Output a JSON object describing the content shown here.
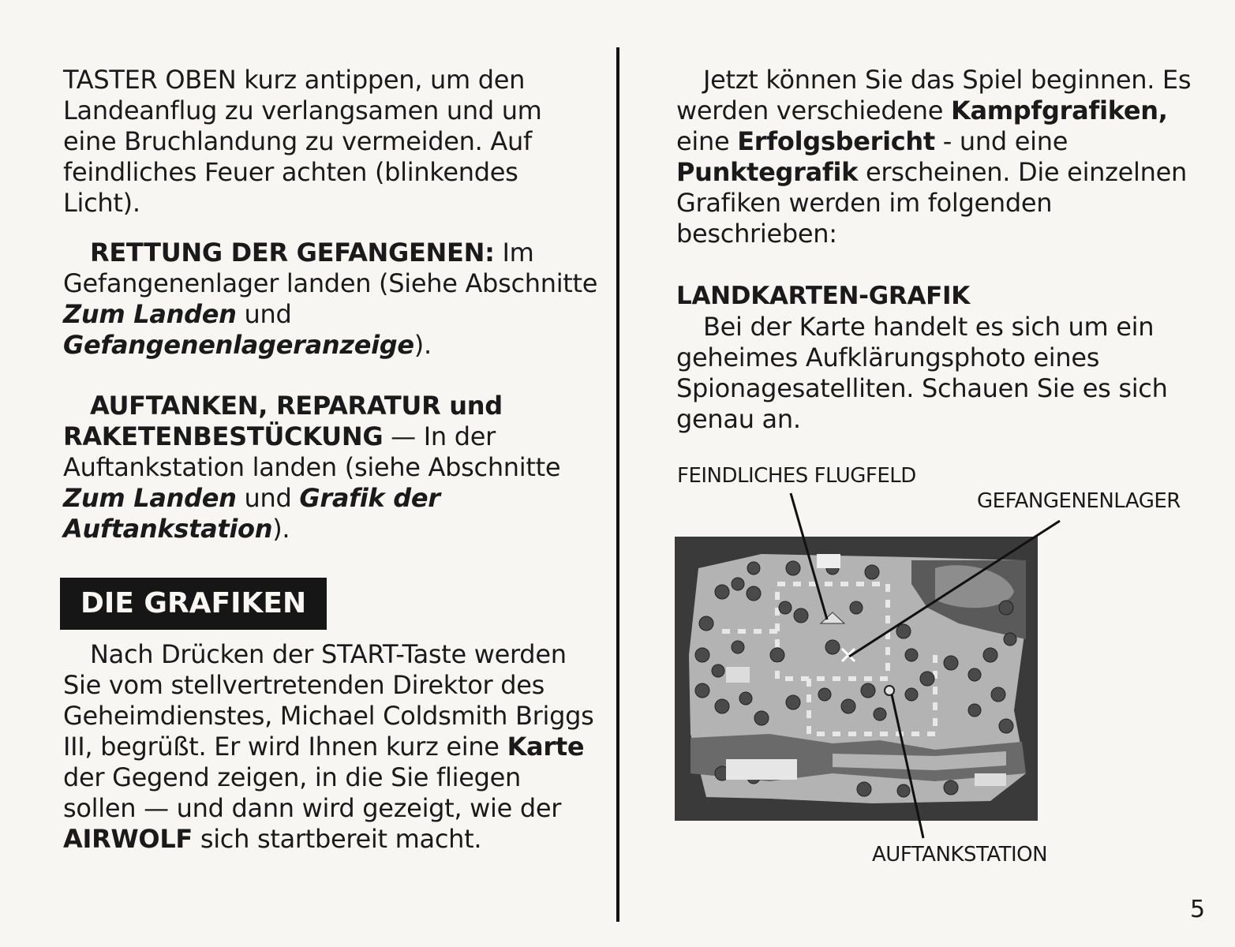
{
  "left": {
    "p1": "TASTER OBEN kurz antippen, um den Landeanflug zu verlangsamen und um eine Bruchlandung zu vermeiden. Auf feindliches Feuer achten (blinkendes Licht).",
    "p2_head": "RETTUNG DER GEFANGENEN:",
    "p2_a": " Im Gefangenenlager landen (Siehe Abschnitte ",
    "p2_b": "Zum Landen",
    "p2_c": " und ",
    "p2_d": "Gefangenenlageranzeige",
    "p2_e": ").",
    "p3_head": "AUFTANKEN, REPARATUR und RAKETENBESTÜCKUNG",
    "p3_a": " — In der Auftankstation landen (siehe Abschnitte ",
    "p3_b": "Zum Landen",
    "p3_c": " und ",
    "p3_d": "Grafik der Auftankstation",
    "p3_e": ").",
    "section_title": "DIE GRAFIKEN",
    "p4_a": "Nach Drücken der START-Taste werden Sie vom stellvertretenden Direktor des Geheimdienstes, Michael Coldsmith Briggs III, begrüßt. Er wird Ihnen kurz eine ",
    "p4_b": "Karte",
    "p4_c": " der Gegend zeigen, in die Sie fliegen sollen — und dann wird gezeigt, wie der ",
    "p4_d": "AIRWOLF",
    "p4_e": " sich startbereit macht."
  },
  "right": {
    "p1_a": "Jetzt können Sie das Spiel beginnen. Es werden verschiedene ",
    "p1_b": "Kampfgrafiken,",
    "p1_c": " eine ",
    "p1_d": "Erfolgsbericht",
    "p1_e": " - und eine ",
    "p1_f": "Punktegrafik",
    "p1_g": " erscheinen. Die einzelnen Grafiken werden im folgenden beschrieben:",
    "heading": "LANDKARTEN-GRAFIK",
    "p2": "Bei der Karte handelt es sich um ein geheimes Aufklärungsphoto eines Spionagesatelliten. Schauen Sie es sich genau an."
  },
  "figure": {
    "label_airfield": "FEINDLICHES FLUGFELD",
    "label_camp": "GEFANGENENLAGER",
    "label_station": "AUFTANKSTATION"
  },
  "page_number": "5"
}
